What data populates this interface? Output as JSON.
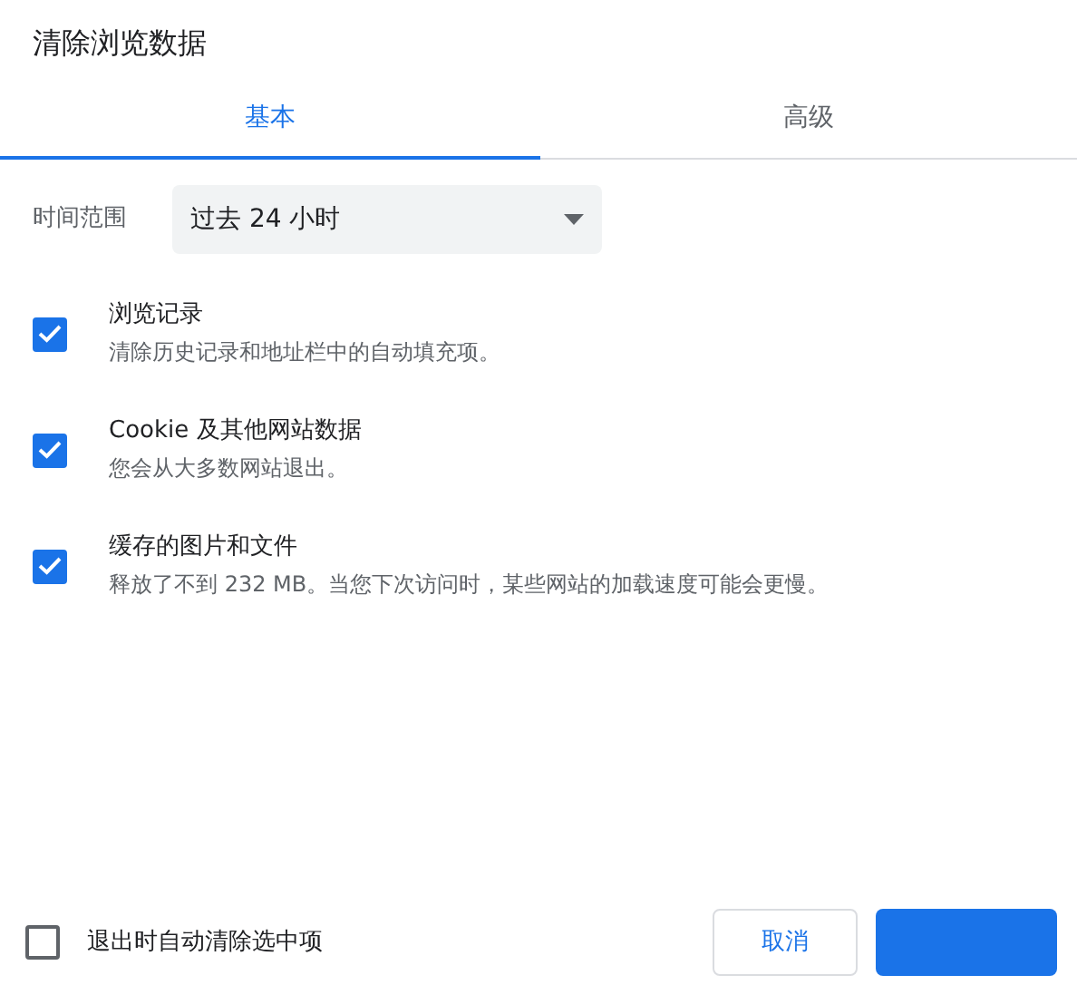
{
  "dialog": {
    "title": "清除浏览数据"
  },
  "tabs": [
    {
      "label": "基本",
      "selected": true
    },
    {
      "label": "高级",
      "selected": false
    }
  ],
  "time_range": {
    "label": "时间范围",
    "value": "过去 24 小时"
  },
  "options": [
    {
      "title": "浏览记录",
      "description": "清除历史记录和地址栏中的自动填充项。",
      "checked": true
    },
    {
      "title": "Cookie 及其他网站数据",
      "description": "您会从大多数网站退出。",
      "checked": true
    },
    {
      "title": "缓存的图片和文件",
      "description": "释放了不到 232 MB。当您下次访问时，某些网站的加载速度可能会更慢。",
      "checked": true
    }
  ],
  "footer": {
    "auto_clear": {
      "label": "退出时自动清除选中项",
      "checked": false
    },
    "buttons": [
      {
        "kind": "secondary",
        "label": "取消"
      },
      {
        "kind": "primary"
      }
    ]
  }
}
